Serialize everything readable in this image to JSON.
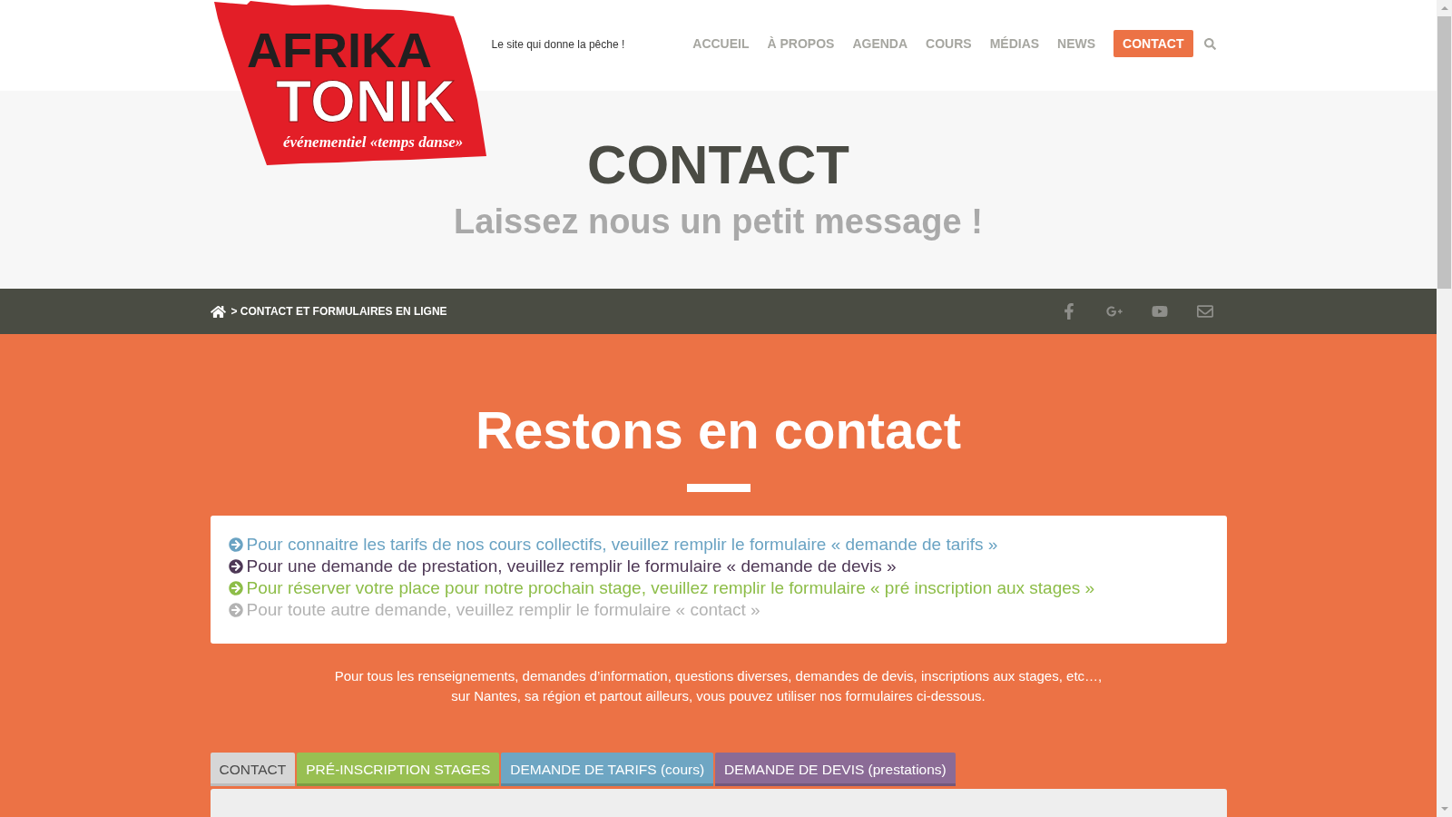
{
  "header": {
    "logo": {
      "line_1": "AFRIKA",
      "line_2": "TONIK",
      "slogan": "événementiel «temps danse»"
    },
    "tagline": "Le site qui donne la pêche !",
    "nav": [
      {
        "label": "ACCUEIL",
        "selected": false
      },
      {
        "label": "À PROPOS",
        "selected": false
      },
      {
        "label": "AGENDA",
        "selected": false
      },
      {
        "label": "COURS",
        "selected": false
      },
      {
        "label": "MÉDIAS",
        "selected": false
      },
      {
        "label": "NEWS",
        "selected": false
      },
      {
        "label": "CONTACT",
        "selected": true
      }
    ]
  },
  "hero": {
    "title": "CONTACT",
    "subtitle": "Laissez nous un petit message !"
  },
  "breadcrumb": {
    "path": "> CONTACT ET FORMULAIRES EN LIGNE"
  },
  "section": {
    "title": "Restons en contact",
    "notices": [
      {
        "text": "Pour connaitre les tarifs de nos cours collectifs, veuillez remplir le formulaire « demande de tarifs »",
        "color": "#6aa3c3"
      },
      {
        "text": "Pour une demande de prestation, veuillez remplir le formulaire « demande de devis »",
        "color": "#4e3856"
      },
      {
        "text": "Pour réserver votre place pour notre prochain stage, veuillez remplir le formulaire « pré inscription aux stages »",
        "color": "#8dbd48"
      },
      {
        "text": "Pour toute autre demande, veuillez remplir le formulaire « contact »",
        "color": "#b3b3b3"
      }
    ],
    "intro": [
      "Pour tous les renseignements, demandes d’information, questions diverses, demandes de devis, inscriptions aux stages, etc…,",
      "sur Nantes, sa région et partout ailleurs, vous pouvez utiliser nos formulaires ci-dessous."
    ],
    "tabs": [
      {
        "label": "CONTACT",
        "selected": true,
        "color": "#d6d6d6"
      },
      {
        "label": "PRÉ-INSCRIPTION STAGES",
        "selected": false,
        "color": "#98bf52"
      },
      {
        "label": "DEMANDE DE TARIFS (cours)",
        "selected": false,
        "color": "#6ea6c3"
      },
      {
        "label": "DEMANDE DE DEVIS (prestations)",
        "selected": false,
        "color": "#8b6b96"
      }
    ]
  }
}
